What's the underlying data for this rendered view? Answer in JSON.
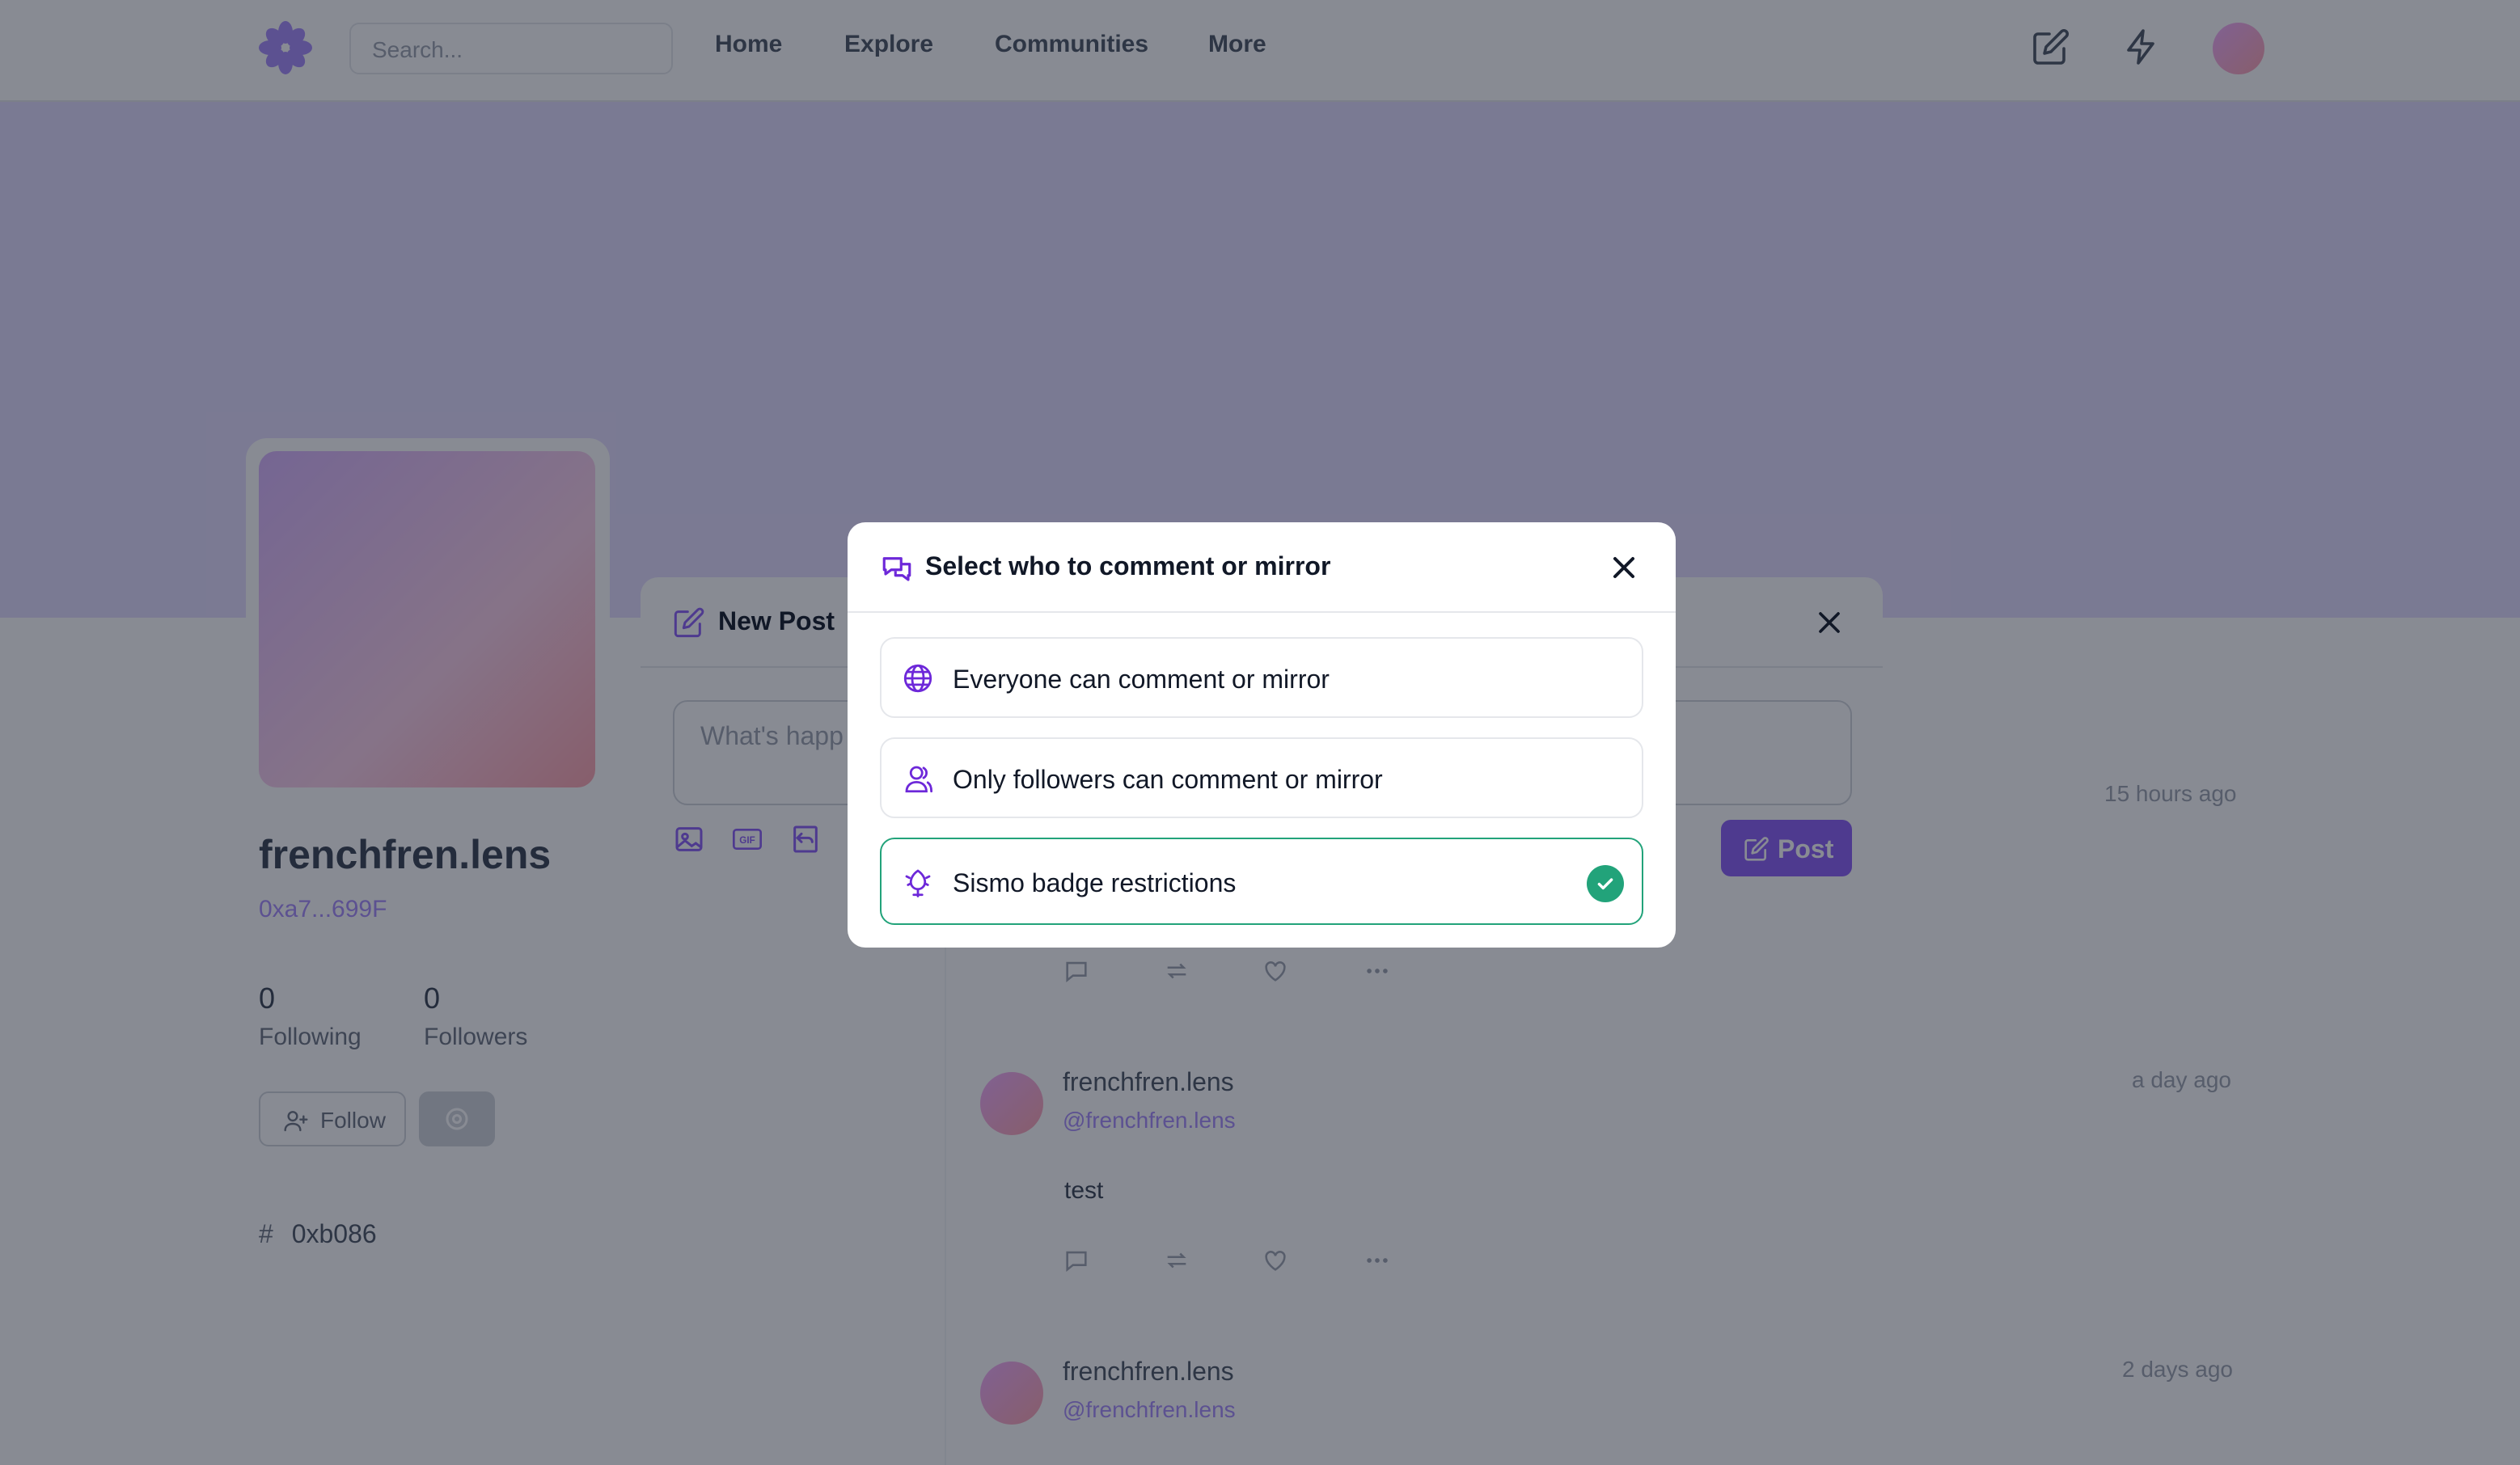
{
  "nav": {
    "search_placeholder": "Search...",
    "links": [
      "Home",
      "Explore",
      "Communities",
      "More"
    ]
  },
  "profile": {
    "handle": "frenchfren.lens",
    "address": "0xa7...699F",
    "following_count": "0",
    "following_label": "Following",
    "followers_count": "0",
    "followers_label": "Followers",
    "follow_label": "Follow",
    "tag": "0xb086"
  },
  "feed": [
    {
      "time": "15 hours ago"
    },
    {
      "name": "frenchfren.lens",
      "username": "@frenchfren.lens",
      "time": "a day ago",
      "text": "test"
    },
    {
      "name": "frenchfren.lens",
      "username": "@frenchfren.lens",
      "time": "2 days ago"
    }
  ],
  "new_post": {
    "title": "New Post",
    "placeholder": "What's happ",
    "post_label": "Post"
  },
  "modal": {
    "title": "Select who to comment or mirror",
    "options": [
      {
        "label": "Everyone can comment or mirror",
        "icon": "globe-icon",
        "selected": false
      },
      {
        "label": "Only followers can comment or mirror",
        "icon": "users-icon",
        "selected": false
      },
      {
        "label": "Sismo badge restrictions",
        "icon": "sismo-icon",
        "selected": true
      }
    ]
  },
  "colors": {
    "accent": "#8b5cf6",
    "selected_border": "#22a37a",
    "overlay": "rgba(17,24,39,0.5)"
  }
}
